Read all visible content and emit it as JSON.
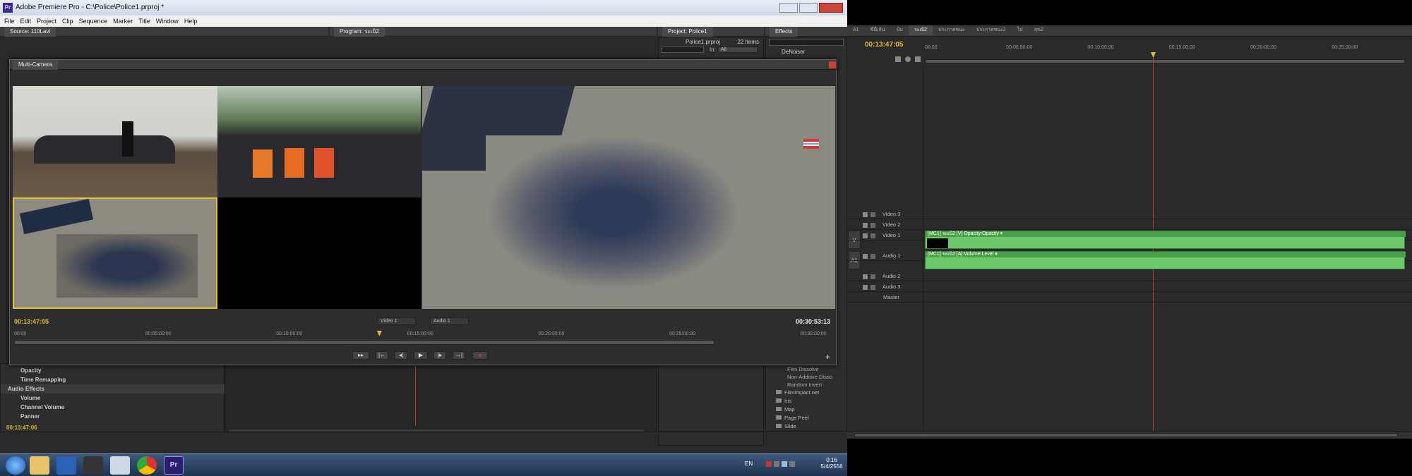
{
  "window": {
    "title": "Adobe Premiere Pro - C:\\Police\\Police1.prproj *",
    "app_icon": "Pr"
  },
  "menu": [
    "File",
    "Edit",
    "Project",
    "Clip",
    "Sequence",
    "Marker",
    "Title",
    "Window",
    "Help"
  ],
  "panels": {
    "source_tab": "Source: 110Lavi",
    "program_tab": "Program: ระเบิ2",
    "project_tab": "Project: Police1",
    "effects_tab": "Effects",
    "project_file": "Police1.prproj",
    "project_items": "22 Items",
    "project_in_label": "In:",
    "project_in_value": "All",
    "effects_denoiser": "DeNoiser"
  },
  "multicam": {
    "title": "Multi-Camera",
    "timecode_left": "00:13:47:05",
    "timecode_right": "00:30:53:13",
    "video_select": "Video 1",
    "audio_select": "Audio 1",
    "ruler": [
      "00:00",
      "00:05:00:00",
      "00:10:00:00",
      "00:15:00:00",
      "00:20:00:00",
      "00:25:00:00",
      "00:30:00:00"
    ],
    "playhead_fraction": 0.443
  },
  "effect_controls": {
    "rows": [
      {
        "label": "Opacity",
        "indent": 1
      },
      {
        "label": "Time Remapping",
        "indent": 1
      },
      {
        "label": "Audio Effects",
        "indent": 0
      },
      {
        "label": "Volume",
        "indent": 1
      },
      {
        "label": "Channel Volume",
        "indent": 1
      },
      {
        "label": "Panner",
        "indent": 1
      }
    ],
    "timecode": "00:13:47:06"
  },
  "effects_list": {
    "items": [
      "Film Dissolve",
      "Non-Additive Disso",
      "Random Invert"
    ],
    "folders": [
      "FilmImpact.net",
      "Iris",
      "Map",
      "Page Peel",
      "Slide"
    ]
  },
  "timeline": {
    "tabs": [
      "A1",
      "ซีนี่เล้น",
      "นับ",
      "ระเบิ2",
      "ประกาศชนะ",
      "ประกาศชนะ2",
      "ไม่",
      "สุข2"
    ],
    "active_tab_index": 3,
    "timecode": "00:13:47:05",
    "ruler": [
      "00:00",
      "00:05:00:00",
      "00:10:00:00",
      "00:15:00:00",
      "00:20:00:00",
      "00:25:00:00"
    ],
    "playhead_fraction": 0.475,
    "tracks": [
      {
        "name": "Video 3",
        "kind": "video"
      },
      {
        "name": "Video 2",
        "kind": "video"
      },
      {
        "name": "Video 1",
        "kind": "video"
      },
      {
        "name": "Audio 1",
        "kind": "audio"
      },
      {
        "name": "Audio 2",
        "kind": "audio"
      },
      {
        "name": "Audio 3",
        "kind": "audio"
      },
      {
        "name": "Master",
        "kind": "master"
      }
    ],
    "side_labels": {
      "v": "V",
      "a": "A1"
    },
    "video_clip_label": "[MC1] ระเบิ2 [V]  Opacity:Opacity ▾",
    "audio_clip_label": "[MC1] ระเบิ2 [A]  Volume:Level ▾"
  },
  "taskbar": {
    "lang": "EN",
    "time": "0:16",
    "date": "5/4/2556",
    "apps": [
      "windows-start",
      "file-explorer",
      "eset-icon",
      "media-player",
      "document-icon",
      "chrome-icon",
      "premiere-icon"
    ]
  },
  "colors": {
    "accent_yellow": "#e3b83a",
    "clip_green": "#6cca6a",
    "playhead": "#c0392b",
    "panel_bg": "#2d2d2d"
  }
}
